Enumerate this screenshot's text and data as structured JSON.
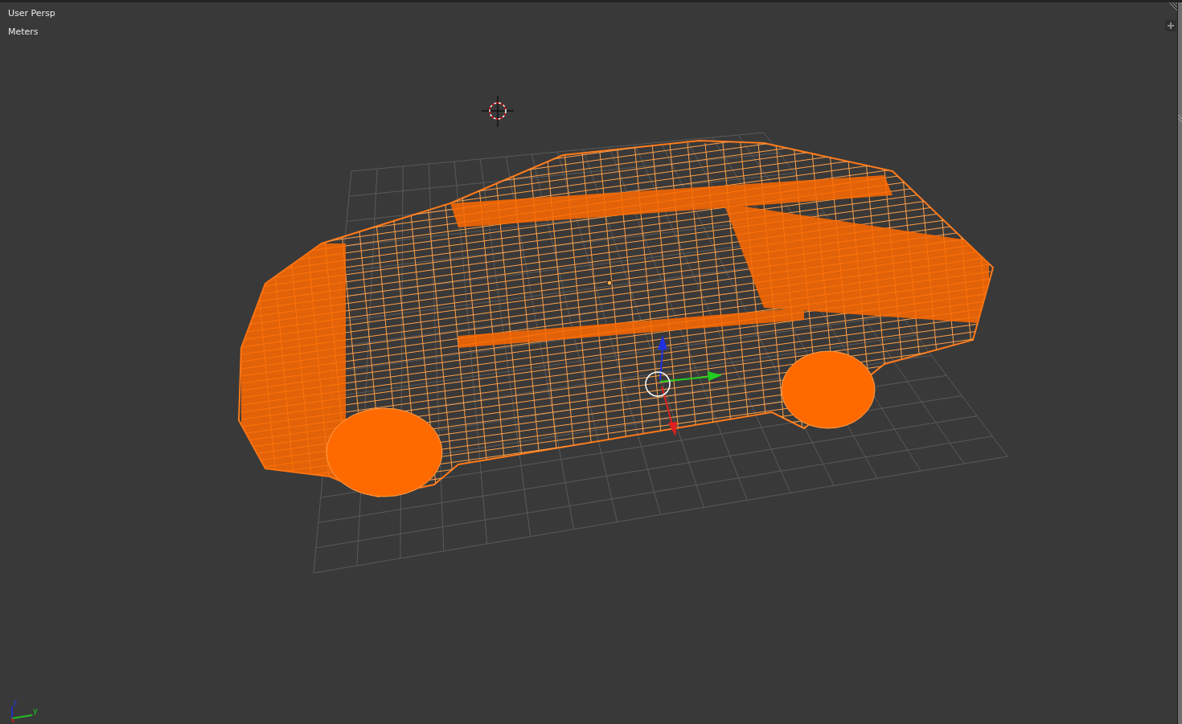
{
  "viewport": {
    "view_name": "User Persp",
    "units": "Meters"
  },
  "axis_widget": {
    "labels": [
      "z",
      "y"
    ]
  }
}
